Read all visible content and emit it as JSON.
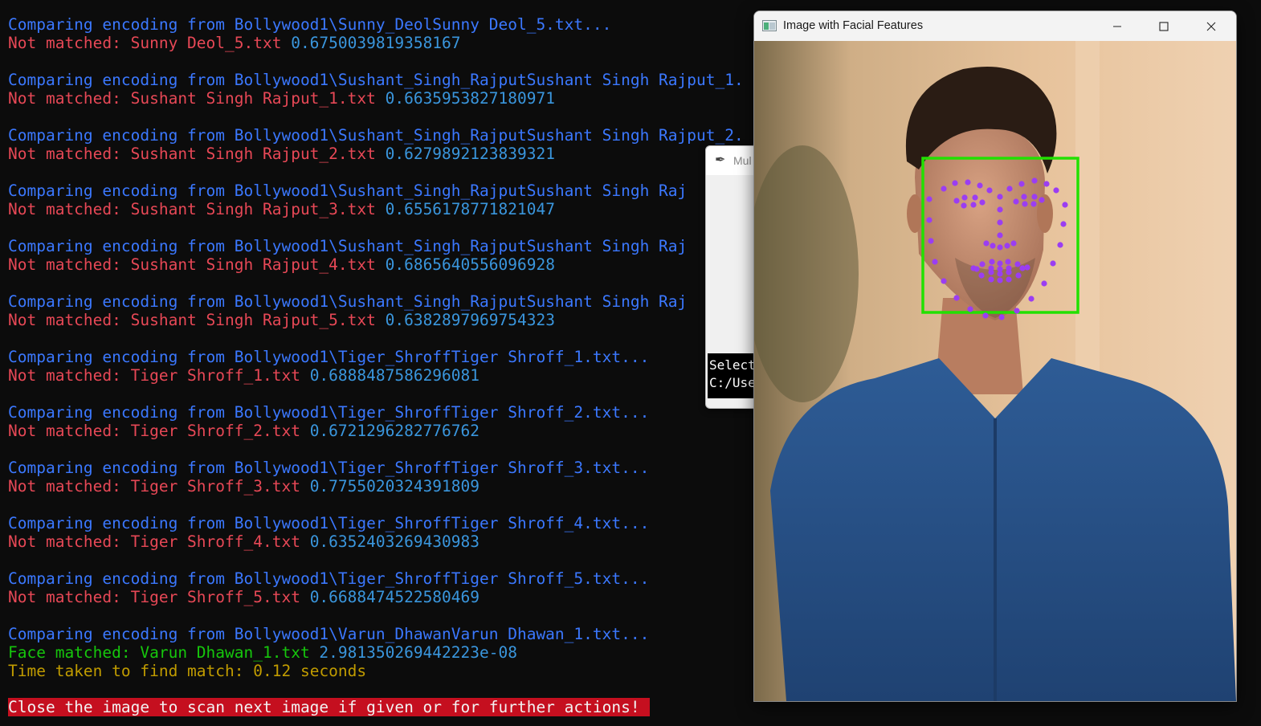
{
  "terminal": {
    "lines": [
      {
        "text": "Comparing encoding from Bollywood1\\Sunny_DeolSunny Deol_5.txt...",
        "color": "#3b78ff"
      },
      {
        "text": "Not matched: Sunny Deol_5.txt ",
        "value": "0.6750039819358167",
        "color": "#e74856"
      },
      {
        "text": "Comparing encoding from Bollywood1\\Sushant_Singh_RajputSushant Singh Rajput_1.",
        "color": "#3b78ff"
      },
      {
        "text": "Not matched: Sushant Singh Rajput_1.txt ",
        "value": "0.6635953827180971",
        "color": "#e74856"
      },
      {
        "text": "Comparing encoding from Bollywood1\\Sushant_Singh_RajputSushant Singh Rajput_2.",
        "color": "#3b78ff"
      },
      {
        "text": "Not matched: Sushant Singh Rajput_2.txt ",
        "value": "0.6279892123839321",
        "color": "#e74856"
      },
      {
        "text": "Comparing encoding from Bollywood1\\Sushant_Singh_RajputSushant Singh Raj",
        "color": "#3b78ff"
      },
      {
        "text": "Not matched: Sushant Singh Rajput_3.txt ",
        "value": "0.6556178771821047",
        "color": "#e74856"
      },
      {
        "text": "Comparing encoding from Bollywood1\\Sushant_Singh_RajputSushant Singh Raj",
        "color": "#3b78ff"
      },
      {
        "text": "Not matched: Sushant Singh Rajput_4.txt ",
        "value": "0.6865640556096928",
        "color": "#e74856"
      },
      {
        "text": "Comparing encoding from Bollywood1\\Sushant_Singh_RajputSushant Singh Raj",
        "color": "#3b78ff"
      },
      {
        "text": "Not matched: Sushant Singh Rajput_5.txt ",
        "value": "0.6382897969754323",
        "color": "#e74856"
      },
      {
        "text": "Comparing encoding from Bollywood1\\Tiger_ShroffTiger Shroff_1.txt...",
        "color": "#3b78ff"
      },
      {
        "text": "Not matched: Tiger Shroff_1.txt ",
        "value": "0.6888487586296081",
        "color": "#e74856"
      },
      {
        "text": "Comparing encoding from Bollywood1\\Tiger_ShroffTiger Shroff_2.txt...",
        "color": "#3b78ff"
      },
      {
        "text": "Not matched: Tiger Shroff_2.txt ",
        "value": "0.6721296282776762",
        "color": "#e74856"
      },
      {
        "text": "Comparing encoding from Bollywood1\\Tiger_ShroffTiger Shroff_3.txt...",
        "color": "#3b78ff"
      },
      {
        "text": "Not matched: Tiger Shroff_3.txt ",
        "value": "0.7755020324391809",
        "color": "#e74856"
      },
      {
        "text": "Comparing encoding from Bollywood1\\Tiger_ShroffTiger Shroff_4.txt...",
        "color": "#3b78ff"
      },
      {
        "text": "Not matched: Tiger Shroff_4.txt ",
        "value": "0.6352403269430983",
        "color": "#e74856"
      },
      {
        "text": "Comparing encoding from Bollywood1\\Tiger_ShroffTiger Shroff_5.txt...",
        "color": "#3b78ff"
      },
      {
        "text": "Not matched: Tiger Shroff_5.txt ",
        "value": "0.6688474522580469",
        "color": "#e74856"
      },
      {
        "text": "Comparing encoding from Bollywood1\\Varun_DhawanVarun Dhawan_1.txt...",
        "color": "#3b78ff"
      },
      {
        "text": "Face matched: Varun Dhawan_1.txt ",
        "value": "2.981350269442223e-08",
        "color": "#16c60c"
      },
      {
        "text": "Time taken to find match: ",
        "value": "0.12",
        "suffix": " seconds",
        "color": "#c19c00"
      }
    ],
    "value_color": "#3a96dd",
    "banner": "Close the image to scan next image if given or for further actions!"
  },
  "background_window": {
    "title": "Mul",
    "console_lines": [
      "Select",
      "C:/Use"
    ]
  },
  "image_window": {
    "title": "Image with Facial Features",
    "app_icon": "opencv-window-icon",
    "buttons": [
      "minimize-icon",
      "maximize-icon",
      "close-icon"
    ],
    "face_box_color": "#22e000",
    "landmark_color": "#9b3df2"
  }
}
